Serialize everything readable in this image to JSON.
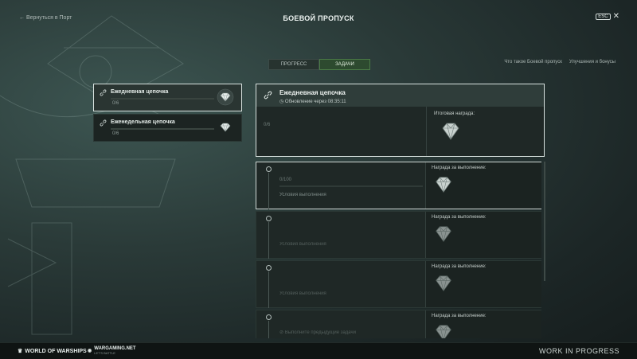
{
  "header": {
    "back_label": "← Вернуться в Порт",
    "title": "БОЕВОЙ ПРОПУСК",
    "esc_key": "ESC",
    "close_glyph": "✕"
  },
  "tabs": [
    {
      "label": "ПРОГРЕСС",
      "active": false
    },
    {
      "label": "ЗАДАЧИ",
      "active": true
    }
  ],
  "top_links": [
    {
      "label": "Что такое Боевой пропуск"
    },
    {
      "label": "Улучшения и бонусы"
    }
  ],
  "chains": [
    {
      "name": "Ежедневная цепочка",
      "progress": "0/6",
      "selected": true,
      "icon": "link-icon",
      "reward_icon": "gem-icon"
    },
    {
      "name": "Еженедельная цепочка",
      "progress": "0/6",
      "selected": false,
      "icon": "link-icon",
      "reward_icon": "gem-icon"
    }
  ],
  "detail": {
    "name": "Ежедневная цепочка",
    "timer": "Обновление через 08:35:11",
    "progress": "0/6",
    "reward_label": "Итоговая награда:"
  },
  "tasks": [
    {
      "progress": "0/100",
      "condition_label": "Условия выполнения",
      "reward_label": "Награда за выполнение:"
    },
    {
      "progress": "",
      "condition_label": "Условия выполнения",
      "reward_label": "Награда за выполнение:"
    },
    {
      "progress": "",
      "condition_label": "Условия выполнения",
      "reward_label": "Награда за выполнение:"
    },
    {
      "progress": "",
      "condition_label": "Выполните предыдущие задачи",
      "reward_label": "Награда за выполнение:"
    }
  ],
  "footer": {
    "logo_game": "WORLD OF WARSHIPS",
    "logo_publisher": "WARGAMING.NET",
    "logo_publisher_sub": "LET'S BATTLE",
    "status": "WORK IN PROGRESS"
  },
  "colors": {
    "active_tab": "#2d4a2f",
    "selected_border": "#d8e2df",
    "background": "#2a3a38"
  }
}
